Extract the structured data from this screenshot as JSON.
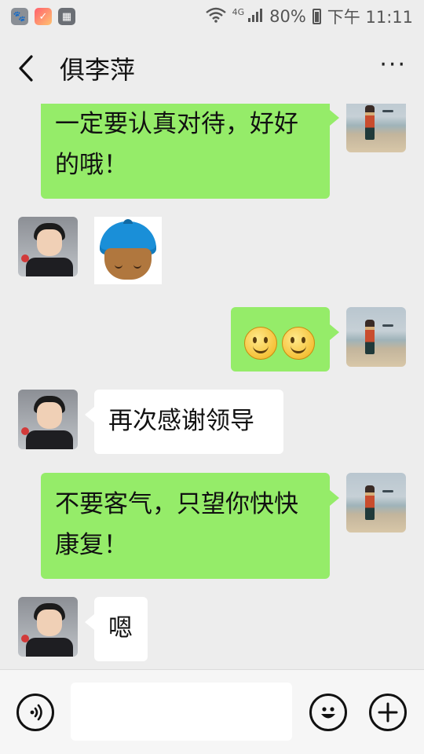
{
  "status_bar": {
    "battery": "80%",
    "time": "下午 11:11",
    "network": "4G"
  },
  "header": {
    "title": "俱李萍",
    "more_label": "···"
  },
  "messages": [
    {
      "side": "sent",
      "type": "text",
      "text": "一定要认真对待，好好的哦！"
    },
    {
      "side": "received",
      "type": "sticker",
      "sticker": "blue-cap-boy-sticker"
    },
    {
      "side": "sent",
      "type": "emoji",
      "emoji": [
        "smile-emoji",
        "smile-emoji"
      ]
    },
    {
      "side": "received",
      "type": "text",
      "text": "再次感谢领导"
    },
    {
      "side": "sent",
      "type": "text",
      "text": "不要客气，只望你快快康复！"
    },
    {
      "side": "received",
      "type": "text",
      "text": "嗯"
    }
  ],
  "composer": {
    "placeholder": ""
  },
  "colors": {
    "sent_bubble": "#95ec69",
    "received_bubble": "#ffffff",
    "background": "#ededed"
  }
}
